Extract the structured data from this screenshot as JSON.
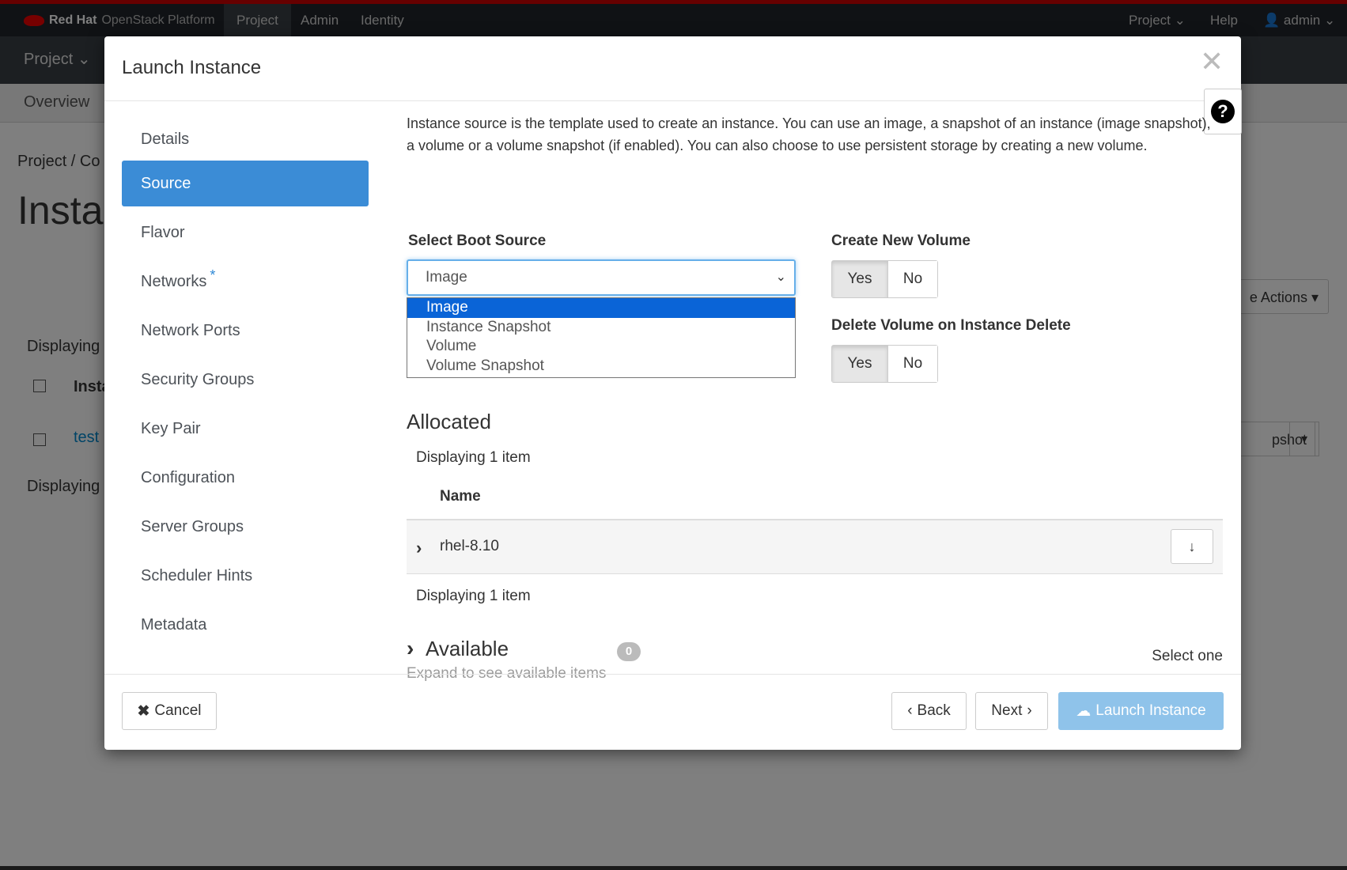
{
  "topnav": {
    "brand_bold": "Red Hat",
    "brand_rest": "OpenStack Platform",
    "tabs": [
      "Project",
      "Admin",
      "Identity"
    ],
    "right": {
      "project": "Project",
      "help": "Help",
      "user": "admin"
    }
  },
  "secnav": {
    "project": "Project"
  },
  "tabnav": {
    "overview": "Overview"
  },
  "background": {
    "breadcrumb": "Project /  Co",
    "page_title": "Insta",
    "displaying_top": "Displaying",
    "col_instance": "Insta",
    "row_link": "test",
    "displaying_bottom": "Displaying",
    "actions_btn": "e Actions",
    "snapshot_btn": "pshot"
  },
  "modal": {
    "title": "Launch Instance",
    "nav": [
      {
        "label": "Details",
        "active": false
      },
      {
        "label": "Source",
        "active": true
      },
      {
        "label": "Flavor",
        "active": false
      },
      {
        "label": "Networks",
        "active": false,
        "required": true
      },
      {
        "label": "Network Ports",
        "active": false
      },
      {
        "label": "Security Groups",
        "active": false
      },
      {
        "label": "Key Pair",
        "active": false
      },
      {
        "label": "Configuration",
        "active": false
      },
      {
        "label": "Server Groups",
        "active": false
      },
      {
        "label": "Scheduler Hints",
        "active": false
      },
      {
        "label": "Metadata",
        "active": false
      }
    ],
    "description": "Instance source is the template used to create an instance. You can use an image, a snapshot of an instance (image snapshot), a volume or a volume snapshot (if enabled). You can also choose to use persistent storage by creating a new volume.",
    "boot_source": {
      "label": "Select Boot Source",
      "value": "Image",
      "options": [
        "Image",
        "Instance Snapshot",
        "Volume",
        "Volume Snapshot"
      ]
    },
    "create_volume": {
      "label": "Create New Volume",
      "yes": "Yes",
      "no": "No"
    },
    "delete_volume": {
      "label": "Delete Volume on Instance Delete",
      "yes": "Yes",
      "no": "No"
    },
    "allocated": {
      "title": "Allocated",
      "displaying_top": "Displaying 1 item",
      "col_name": "Name",
      "rows": [
        {
          "name": "rhel-8.10"
        }
      ],
      "displaying_bottom": "Displaying 1 item"
    },
    "available": {
      "title": "Available",
      "count": "0",
      "hint": "Expand to see available items",
      "select_one": "Select one"
    },
    "footer": {
      "cancel": "Cancel",
      "back": "Back",
      "next": "Next",
      "launch": "Launch Instance"
    }
  }
}
